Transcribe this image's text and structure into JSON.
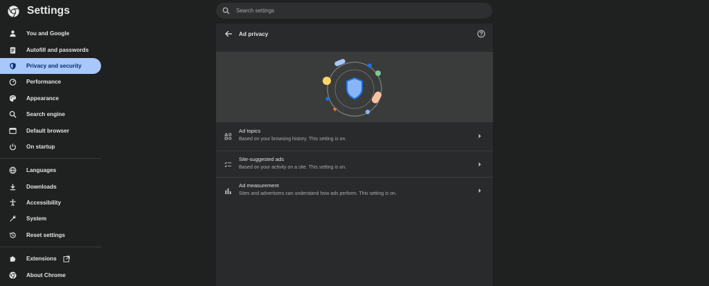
{
  "app": {
    "title": "Settings",
    "logo_icon": "chrome-logo-icon"
  },
  "search": {
    "placeholder": "Search settings",
    "icon": "search-icon"
  },
  "sidebar": {
    "items": [
      {
        "label": "You and Google",
        "icon": "person-icon"
      },
      {
        "label": "Autofill and passwords",
        "icon": "clipboard-icon"
      },
      {
        "label": "Privacy and security",
        "icon": "shield-icon",
        "active": true
      },
      {
        "label": "Performance",
        "icon": "speedometer-icon"
      },
      {
        "label": "Appearance",
        "icon": "palette-icon"
      },
      {
        "label": "Search engine",
        "icon": "search-icon"
      },
      {
        "label": "Default browser",
        "icon": "browser-icon"
      },
      {
        "label": "On startup",
        "icon": "power-icon"
      },
      {
        "label": "Languages",
        "icon": "globe-icon"
      },
      {
        "label": "Downloads",
        "icon": "download-icon"
      },
      {
        "label": "Accessibility",
        "icon": "accessibility-icon"
      },
      {
        "label": "System",
        "icon": "wrench-icon"
      },
      {
        "label": "Reset settings",
        "icon": "reset-icon"
      },
      {
        "label": "Extensions",
        "icon": "puzzle-icon",
        "external": true
      },
      {
        "label": "About Chrome",
        "icon": "chrome-logo-icon"
      }
    ]
  },
  "page": {
    "title": "Ad privacy",
    "back_icon": "arrow-back-icon",
    "help_icon": "help-icon",
    "rows": [
      {
        "title": "Ad topics",
        "subtitle": "Based on your browsing history. This setting is on.",
        "icon": "ad-topics-icon"
      },
      {
        "title": "Site-suggested ads",
        "subtitle": "Based on your activity on a site. This setting is on.",
        "icon": "checklist-icon"
      },
      {
        "title": "Ad measurement",
        "subtitle": "Sites and advertisers can understand how ads perform. This setting is on.",
        "icon": "bar-chart-icon"
      }
    ]
  },
  "colors": {
    "background": "#1f2020",
    "panel": "#282a2c",
    "hero": "#3a3c3c",
    "active_nav": "#a8c7fa",
    "active_nav_text": "#062e6f",
    "shield_blue": "#8ab4f8"
  }
}
